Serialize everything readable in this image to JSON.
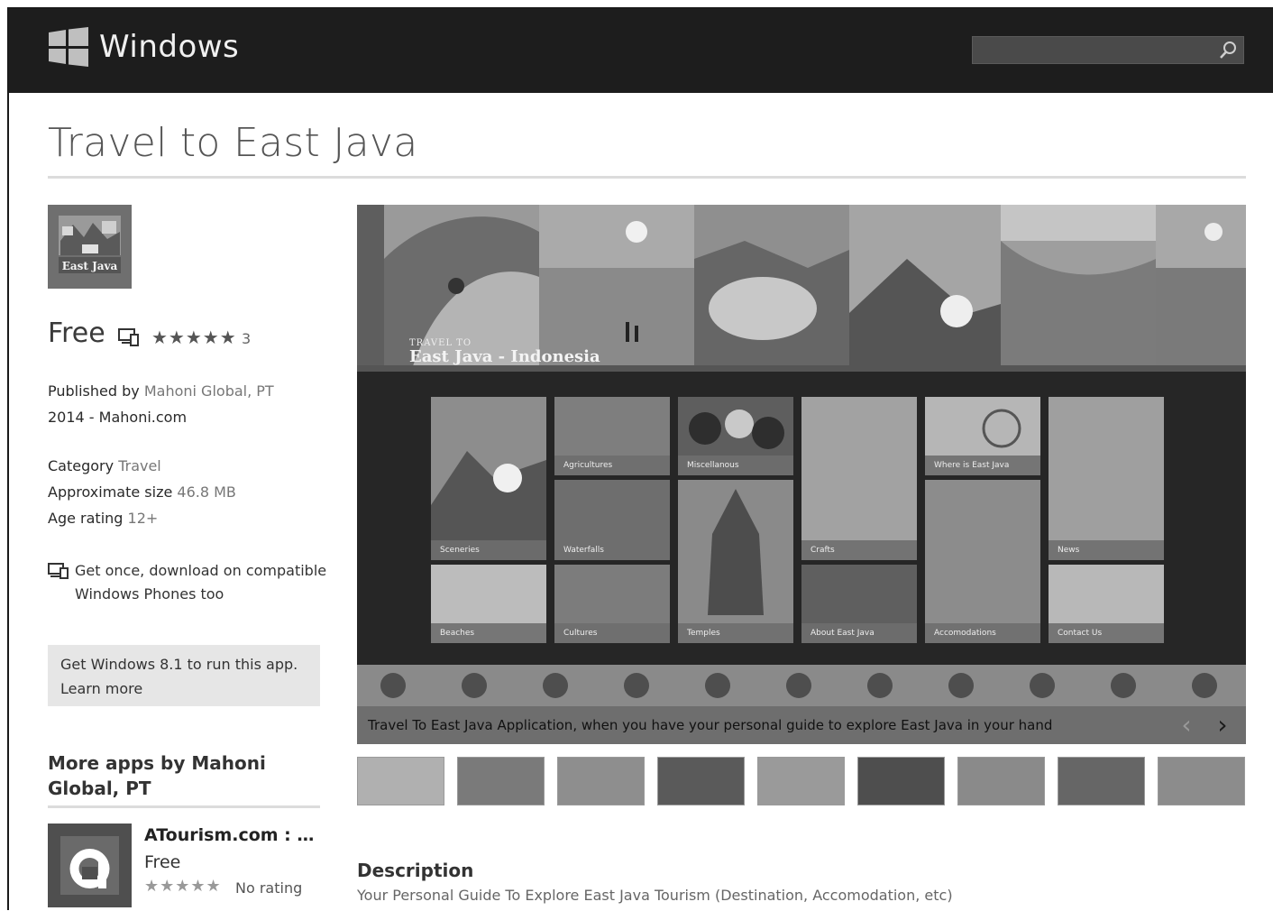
{
  "header": {
    "brand": "Windows",
    "search_placeholder": ""
  },
  "app": {
    "title": "Travel to East Java",
    "icon_text": "East Java",
    "price": "Free",
    "stars": "★★★★★",
    "rating_count": "3",
    "published_by_label": "Published by",
    "publisher": "Mahoni Global, PT",
    "copyright": "2014 - Mahoni.com",
    "category_label": "Category",
    "category": "Travel",
    "size_label": "Approximate size",
    "size": "46.8 MB",
    "age_label": "Age rating",
    "age": "12+",
    "get_once": "Get once, download on compatible Windows Phones too",
    "win_notice": "Get Windows 8.1 to run this app.",
    "learn_more": "Learn more"
  },
  "more_apps": {
    "title": "More apps by Mahoni Global, PT",
    "items": [
      {
        "name": "ATourism.com : …",
        "price": "Free",
        "stars": "★★★★★",
        "rating": "No rating"
      }
    ]
  },
  "viewer": {
    "banner_small": "TRAVEL TO",
    "banner_title": "East Java - Indonesia",
    "tiles": [
      "Sceneries",
      "Agricultures",
      "Miscellanous",
      "Crafts",
      "Where is East Java",
      "News",
      "Waterfalls",
      "Temples",
      "Accomodations",
      "Beaches",
      "Cultures",
      "About East Java",
      "Contact Us"
    ],
    "caption": "Travel To East Java Application, when you have your personal guide to explore East Java in your hand",
    "prev": "‹",
    "next": "›"
  },
  "description": {
    "title": "Description",
    "text": "Your Personal Guide To Explore East Java Tourism (Destination, Accomodation, etc)"
  }
}
